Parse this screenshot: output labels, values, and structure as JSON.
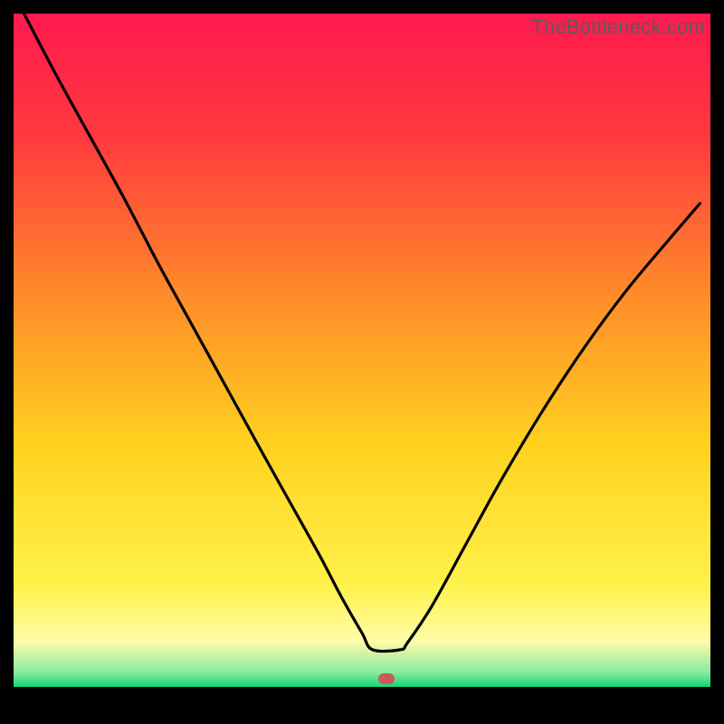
{
  "watermark": "TheBottleneck.com",
  "marker": {
    "color": "#cc5a52",
    "x_frac": 0.535,
    "y_frac": 0.955
  },
  "chart_data": {
    "type": "line",
    "title": "",
    "xlabel": "",
    "ylabel": "",
    "xlim": [
      0,
      1
    ],
    "ylim": [
      0,
      1
    ],
    "background_gradient": [
      {
        "stop": 0.0,
        "color": "#ff1a4f"
      },
      {
        "stop": 0.18,
        "color": "#ff3a3e"
      },
      {
        "stop": 0.4,
        "color": "#ff8a2a"
      },
      {
        "stop": 0.62,
        "color": "#ffd21f"
      },
      {
        "stop": 0.82,
        "color": "#fff24a"
      },
      {
        "stop": 0.9,
        "color": "#fffca8"
      },
      {
        "stop": 0.945,
        "color": "#8beaa0"
      },
      {
        "stop": 0.965,
        "color": "#17d87b"
      }
    ],
    "series": [
      {
        "name": "bottleneck-curve",
        "color": "#000000",
        "x": [
          0.015,
          0.06,
          0.11,
          0.16,
          0.21,
          0.26,
          0.31,
          0.36,
          0.4,
          0.44,
          0.47,
          0.5,
          0.515,
          0.555,
          0.565,
          0.6,
          0.65,
          0.7,
          0.76,
          0.82,
          0.88,
          0.94,
          0.985
        ],
        "y": [
          1.0,
          0.91,
          0.815,
          0.72,
          0.62,
          0.525,
          0.43,
          0.335,
          0.26,
          0.185,
          0.125,
          0.07,
          0.045,
          0.045,
          0.055,
          0.11,
          0.205,
          0.3,
          0.405,
          0.5,
          0.585,
          0.66,
          0.715
        ]
      }
    ],
    "flat_segment": {
      "x": [
        0.515,
        0.555
      ],
      "y": 0.045
    },
    "marker_point": {
      "x": 0.535,
      "y": 0.045,
      "color": "#cc5a52"
    }
  }
}
